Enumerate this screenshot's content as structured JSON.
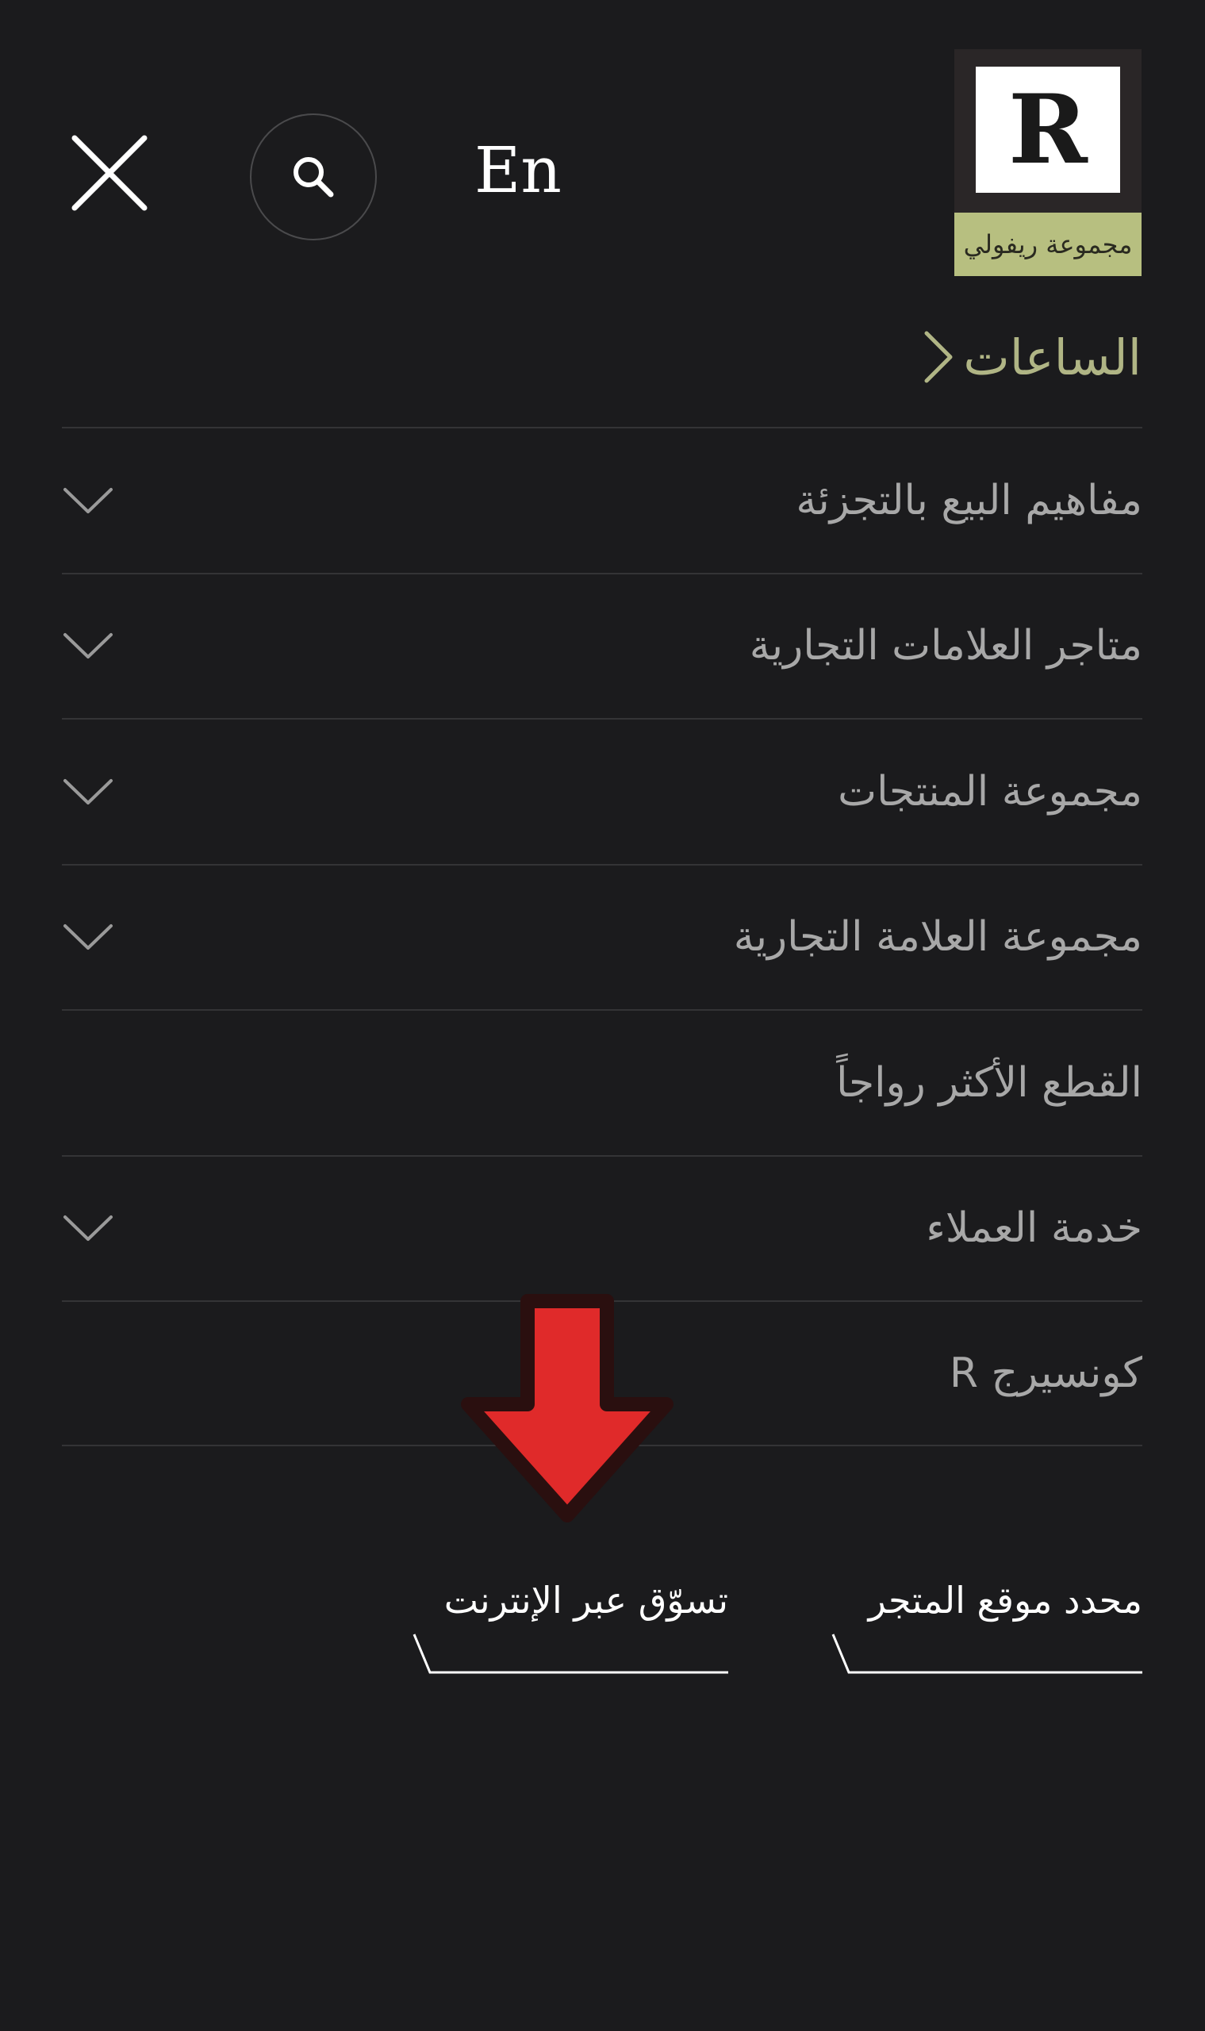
{
  "header": {
    "close_icon": "close-icon",
    "search_icon": "search-icon",
    "language_toggle": "En",
    "logo": {
      "letter": "R",
      "caption": "مجموعة ريفولي",
      "caption_bg": "#b7bf80"
    }
  },
  "featured_link": {
    "label": "الساعات",
    "icon": "chevron-right-icon",
    "color": "#b0b585"
  },
  "menu": [
    {
      "label": "مفاهيم البيع بالتجزئة",
      "expandable": true
    },
    {
      "label": "متاجر العلامات التجارية",
      "expandable": true
    },
    {
      "label": "مجموعة المنتجات",
      "expandable": true
    },
    {
      "label": "مجموعة العلامة التجارية",
      "expandable": true
    },
    {
      "label": "القطع الأكثر رواجاً",
      "expandable": false
    },
    {
      "label": "خدمة العملاء",
      "expandable": true
    },
    {
      "label": "كونسيرج R",
      "expandable": false
    }
  ],
  "footer_links": {
    "store_locator": "محدد موقع المتجر",
    "shop_online": "تسوّق عبر الإنترنت"
  },
  "annotation": {
    "icon": "red-down-arrow-icon",
    "color": "#e02a2a"
  },
  "colors": {
    "background": "#1b1b1d",
    "divider": "#343436",
    "menu_text": "#a8a8a8"
  }
}
